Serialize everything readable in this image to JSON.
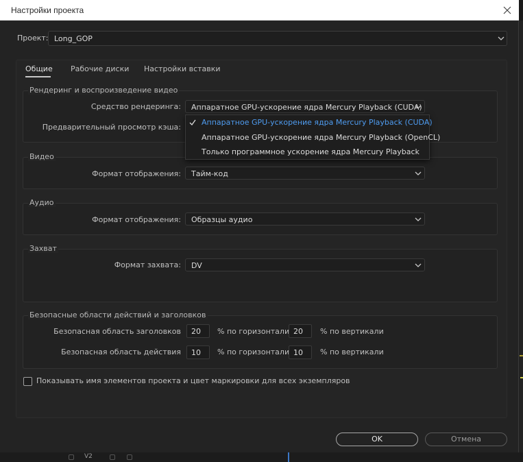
{
  "window": {
    "title": "Настройки проекта"
  },
  "project": {
    "label": "Проект:",
    "value": "Long_GOP"
  },
  "tabs": [
    {
      "label": "Общие",
      "active": true
    },
    {
      "label": "Рабочие диски",
      "active": false
    },
    {
      "label": "Настройки вставки",
      "active": false
    }
  ],
  "rendering": {
    "group_title": "Рендеринг и воспроизведение видео",
    "renderer_label": "Средство рендеринга:",
    "renderer_value": "Аппаратное GPU-ускорение ядра Mercury Playback (CUDA)",
    "cache_label": "Предварительный просмотр кэша:",
    "options": [
      "Аппаратное GPU-ускорение ядра Mercury Playback (CUDA)",
      "Аппаратное GPU-ускорение ядра Mercury Playback (OpenCL)",
      "Только программное ускорение ядра Mercury Playback"
    ]
  },
  "video": {
    "group_title": "Видео",
    "format_label": "Формат отображения:",
    "format_value": "Тайм-код"
  },
  "audio": {
    "group_title": "Аудио",
    "format_label": "Формат отображения:",
    "format_value": "Образцы аудио"
  },
  "capture": {
    "group_title": "Захват",
    "format_label": "Формат захвата:",
    "format_value": "DV"
  },
  "safe": {
    "group_title": "Безопасные области действий и заголовков",
    "title_label": "Безопасная область заголовков",
    "action_label": "Безопасная область действия",
    "title_h": "20",
    "title_v": "20",
    "action_h": "10",
    "action_v": "10",
    "unit_h": "% по горизонтали",
    "unit_v": "% по вертикали"
  },
  "show_names": {
    "label": "Показывать имя элементов проекта и цвет маркировки для всех экземпляров",
    "checked": false
  },
  "buttons": {
    "ok": "OK",
    "cancel": "Отмена"
  },
  "background": {
    "track_label": "V2"
  },
  "colors": {
    "accent": "#4f9cf0",
    "dialog_bg": "#232323",
    "title_bar": "#ffffff"
  }
}
